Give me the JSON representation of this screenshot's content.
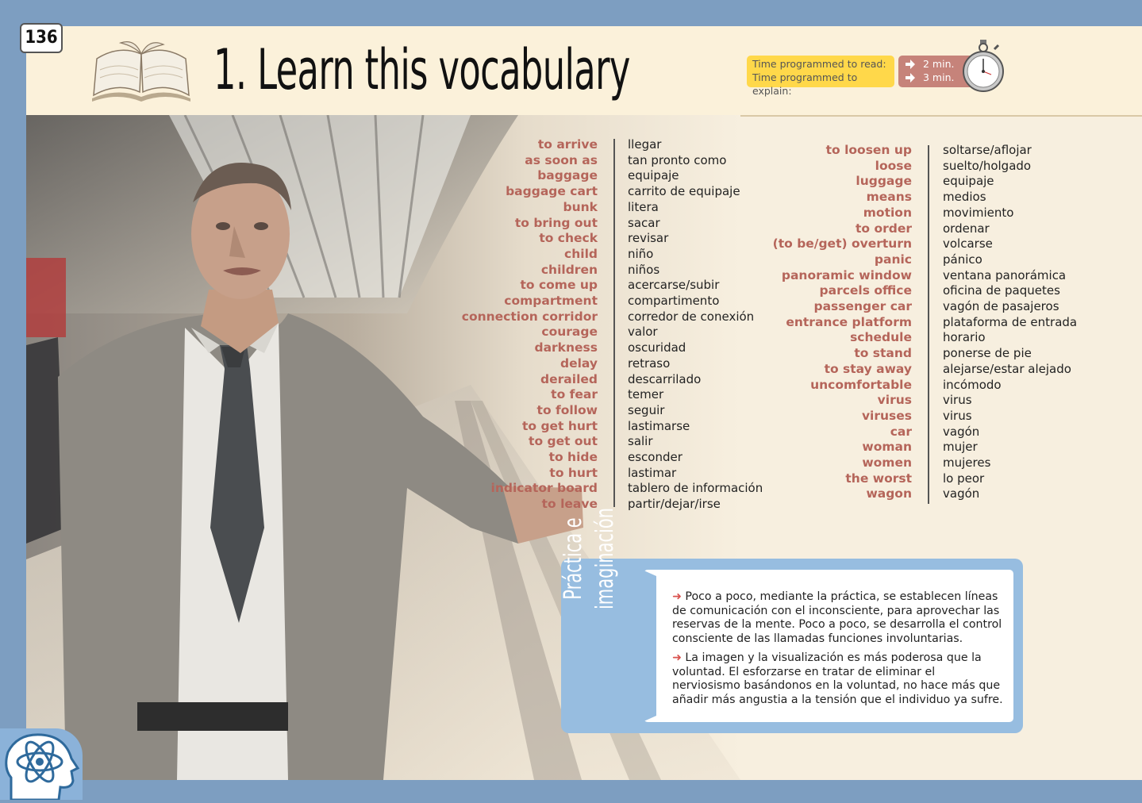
{
  "page_number": "136",
  "title": "1. Learn this vocabulary",
  "time": {
    "read_label": "Time programmed to read:",
    "explain_label": "Time programmed to explain:",
    "read_value": "2 min.",
    "explain_value": "3 min."
  },
  "vocab_left": {
    "english": [
      "to arrive",
      "as soon as",
      "baggage",
      "baggage cart",
      "bunk",
      "to bring out",
      "to check",
      "child",
      "children",
      "to come up",
      "compartment",
      "connection corridor",
      "courage",
      "darkness",
      "delay",
      "derailed",
      "to fear",
      "to follow",
      "to get hurt",
      "to get out",
      "to hide",
      "to hurt",
      "indicator board",
      "to leave"
    ],
    "spanish": [
      "llegar",
      "tan pronto como",
      "equipaje",
      "carrito de equipaje",
      "litera",
      "sacar",
      "revisar",
      "niño",
      "niños",
      "acercarse/subir",
      "compartimento",
      "corredor de conexión",
      "valor",
      "oscuridad",
      "retraso",
      "descarrilado",
      "temer",
      "seguir",
      "lastimarse",
      "salir",
      "esconder",
      "lastimar",
      "tablero de información",
      "partir/dejar/irse"
    ]
  },
  "vocab_right": {
    "english": [
      "to loosen up",
      "loose",
      "luggage",
      "means",
      "motion",
      "to order",
      "(to be/get) overturn",
      "panic",
      "panoramic window",
      "parcels office",
      "passenger car",
      "entrance platform",
      "schedule",
      "to stand",
      "to stay away",
      "uncomfortable",
      "virus",
      "viruses",
      "car",
      "woman",
      "women",
      "the worst",
      "wagon"
    ],
    "spanish": [
      "soltarse/aflojar",
      "suelto/holgado",
      "equipaje",
      "medios",
      "movimiento",
      "ordenar",
      "volcarse",
      "pánico",
      "ventana panorámica",
      "oficina de paquetes",
      "vagón de pasajeros",
      "plataforma de entrada",
      "horario",
      "ponerse de pie",
      "alejarse/estar alejado",
      "incómodo",
      "virus",
      "virus",
      "vagón",
      "mujer",
      "mujeres",
      "lo peor",
      "vagón"
    ]
  },
  "practice": {
    "title_line1": "Práctica e",
    "title_line2": "imaginación",
    "para1": "Poco a poco, mediante la práctica, se establecen líneas de comunicación con el inconsciente, para aprovechar las reservas de la mente. Poco a poco, se desarrolla el control consciente de las llamadas funciones involuntarias.",
    "para2": "La imagen y la visualización es más poderosa que la voluntad. El esforzarse en tratar de eliminar el nerviosismo basándonos en la voluntad, no hace más que añadir más angustia a la tensión que el individuo ya sufre."
  },
  "colors": {
    "english_word": "#b5655a",
    "frame": "#7d9ec1",
    "panel": "#97bde0",
    "time_box": "#ffd84a",
    "time_values": "#c6837a"
  },
  "icons": [
    "open-book-icon",
    "stopwatch-icon",
    "arrow-right-icon",
    "atom-head-icon"
  ]
}
